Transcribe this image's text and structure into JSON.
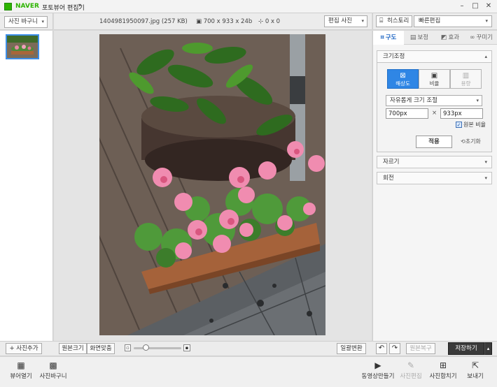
{
  "titlebar": {
    "brand": "NAVER",
    "title": "포토뷰어 편집기",
    "caret": "▾",
    "minimize": "–",
    "maximize": "□",
    "close": "✕"
  },
  "left_panel": {
    "basket_dropdown": "사진 바구니",
    "add_photo_button": "+ 사진추가"
  },
  "center_toolbar": {
    "filename": "1404981950097.jpg (257 KB)",
    "dimensions": "700 x 933 x 24b",
    "coordinates": "0 x 0",
    "edit_photo_dropdown": "편집 사진"
  },
  "right_top": {
    "history_button": "히스토리",
    "quick_edit_dropdown": "빠른편집"
  },
  "tabs": [
    {
      "label": "구도",
      "icon": "crop-icon"
    },
    {
      "label": "보정",
      "icon": "adjust-icon"
    },
    {
      "label": "효과",
      "icon": "effect-icon"
    },
    {
      "label": "꾸미기",
      "icon": "decorate-icon"
    }
  ],
  "resize_section": {
    "title": "크기조정",
    "mode_buttons": [
      {
        "label": "해상도",
        "state": "active"
      },
      {
        "label": "비율",
        "state": "normal"
      },
      {
        "label": "용량",
        "state": "disabled"
      }
    ],
    "mode_dropdown": "자유롭게 크기 조절",
    "width_value": "700px",
    "height_value": "933px",
    "times": "×",
    "keep_ratio_label": "원본 비율",
    "keep_ratio_checked": true,
    "apply_button": "적용",
    "reset_button": "초기화"
  },
  "crop_section": {
    "title": "자르기"
  },
  "rotate_section": {
    "title": "회전"
  },
  "bottom_bar": {
    "original_size_button": "원본크기",
    "fit_screen_button": "화면맞춤",
    "zoom_level": 0.25,
    "batch_convert_button": "일괄변환",
    "undo": "↶",
    "redo": "↷",
    "revert_button": "원본복구",
    "save_button": "저장하기",
    "save_caret": "▴"
  },
  "footer": {
    "viewer_open": "뷰어열기",
    "photo_basket": "사진바구니",
    "make_video": "동영상만들기",
    "photo_edit": "사진편집",
    "photo_merge": "사진합치기",
    "send": "보내기"
  },
  "colors": {
    "accent": "#2f86e5",
    "brand_green": "#2db400",
    "save_dark": "#3a3a3a"
  }
}
